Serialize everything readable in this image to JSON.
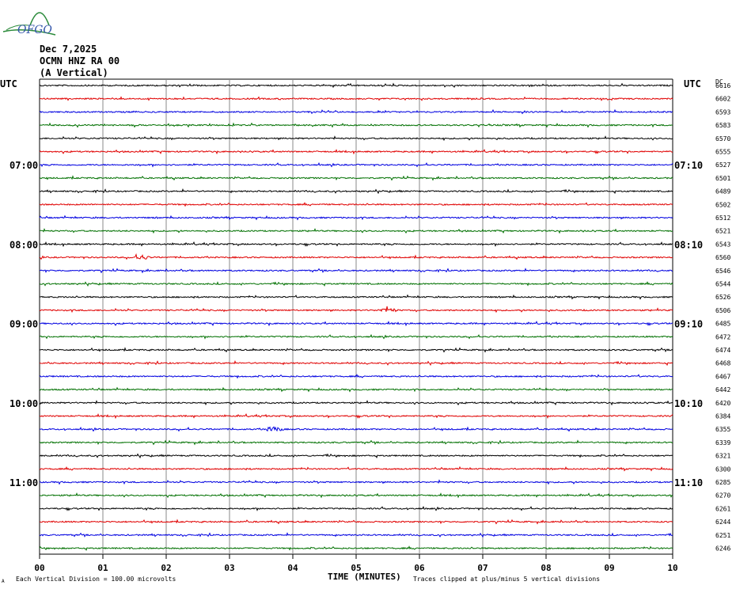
{
  "logo_text": "OFGO",
  "header": {
    "date": "Dec 7,2025",
    "station": "OCMN HNZ RA 00",
    "component": "(A Vertical)"
  },
  "labels": {
    "utc_left": "UTC",
    "utc_right": "UTC",
    "dc_label": "DC",
    "x_axis_title": "TIME (MINUTES)",
    "footer_left": "Each Vertical Division =  100.00 microvolts",
    "footer_right": "Traces clipped at plus/minus 5 vertical divisions",
    "corner_mark": "A"
  },
  "colors": {
    "trace_cycle": [
      "#000000",
      "#e00000",
      "#0000e0",
      "#007000"
    ],
    "grid": "#888888"
  },
  "chart_data": {
    "type": "line",
    "title": "OCMN HNZ RA 00 (A Vertical) — Dec 7,2025",
    "xlabel": "TIME (MINUTES)",
    "xlim": [
      0,
      10
    ],
    "x_ticks": [
      "00",
      "01",
      "02",
      "03",
      "04",
      "05",
      "06",
      "07",
      "08",
      "09",
      "10"
    ],
    "trace_count": 36,
    "left_time_labels": [
      {
        "trace": 6,
        "label": "07:00"
      },
      {
        "trace": 12,
        "label": "08:00"
      },
      {
        "trace": 18,
        "label": "09:00"
      },
      {
        "trace": 24,
        "label": "10:00"
      },
      {
        "trace": 30,
        "label": "11:00"
      }
    ],
    "right_time_labels": [
      {
        "trace": 6,
        "label": "07:10"
      },
      {
        "trace": 12,
        "label": "08:10"
      },
      {
        "trace": 18,
        "label": "09:10"
      },
      {
        "trace": 24,
        "label": "10:10"
      },
      {
        "trace": 30,
        "label": "11:10"
      }
    ],
    "dc_offsets": [
      6616,
      6602,
      6593,
      6583,
      6570,
      6555,
      6527,
      6501,
      6489,
      6502,
      6512,
      6521,
      6543,
      6560,
      6546,
      6544,
      6526,
      6506,
      6485,
      6472,
      6474,
      6468,
      6467,
      6442,
      6420,
      6384,
      6355,
      6339,
      6321,
      6300,
      6285,
      6270,
      6261,
      6244,
      6251,
      6246
    ],
    "events": [
      {
        "trace": 13,
        "minute": 1.6
      },
      {
        "trace": 17,
        "minute": 5.5
      },
      {
        "trace": 26,
        "minute": 3.7
      }
    ]
  }
}
